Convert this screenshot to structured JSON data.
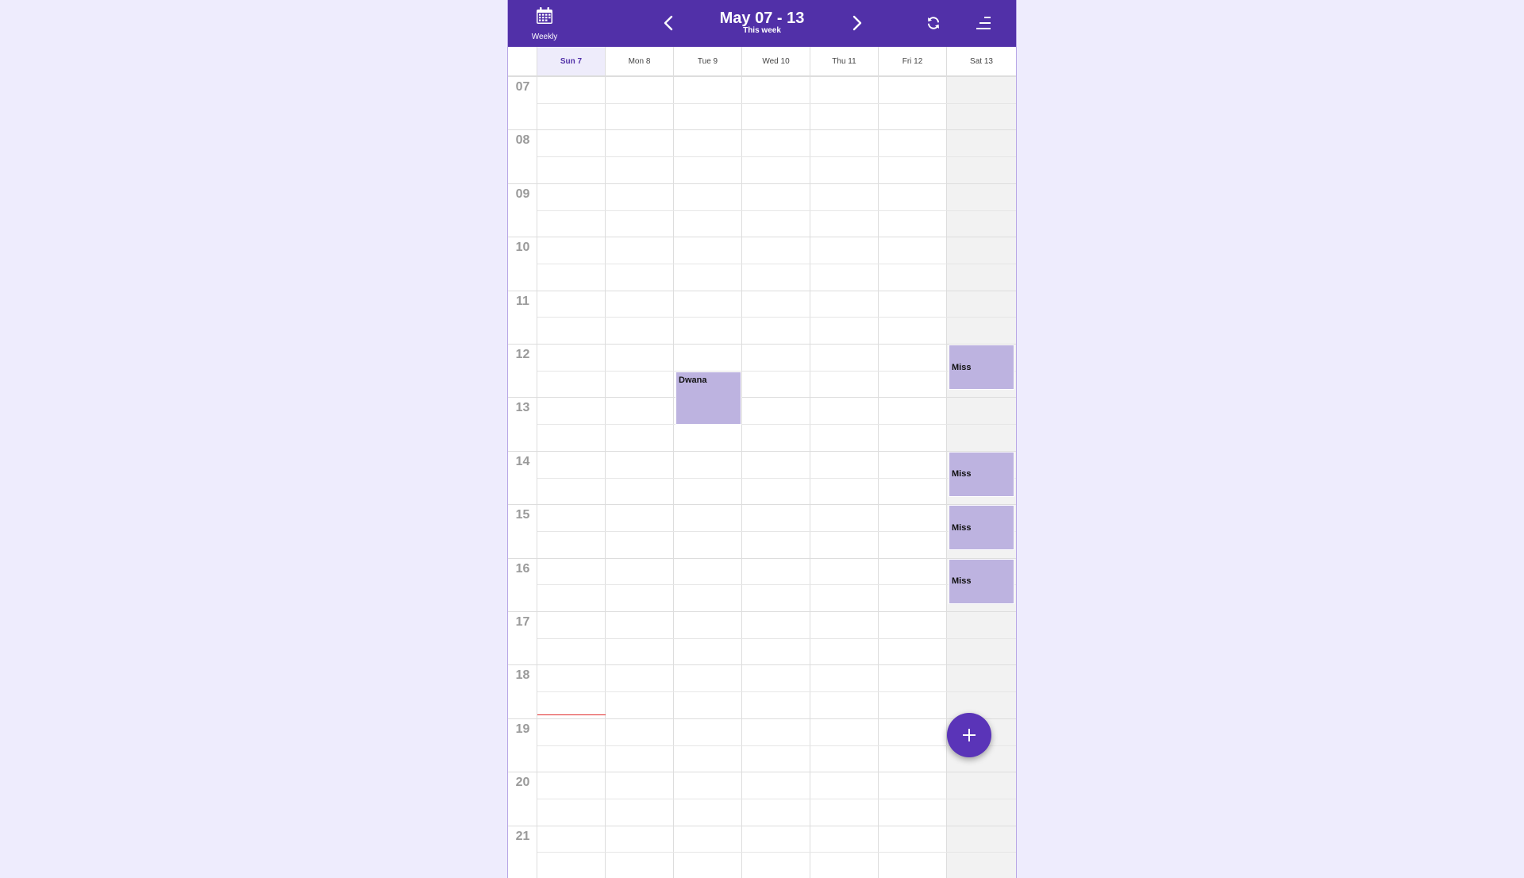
{
  "topbar": {
    "view_label": "Weekly",
    "view_icon": "calendar-icon",
    "title": "May 07 - 13",
    "subtitle": "This week",
    "prev_icon": "chevron-left-icon",
    "next_icon": "chevron-right-icon",
    "refresh_icon": "refresh-icon",
    "menu_icon": "menu-icon",
    "background_color": "#5130a8"
  },
  "days": [
    {
      "label": "Sun 7",
      "today": true,
      "weekend": false
    },
    {
      "label": "Mon 8",
      "today": false,
      "weekend": false
    },
    {
      "label": "Tue 9",
      "today": false,
      "weekend": false
    },
    {
      "label": "Wed 10",
      "today": false,
      "weekend": false
    },
    {
      "label": "Thu 11",
      "today": false,
      "weekend": false
    },
    {
      "label": "Fri 12",
      "today": false,
      "weekend": false
    },
    {
      "label": "Sat 13",
      "today": false,
      "weekend": true
    }
  ],
  "hours": [
    "07",
    "08",
    "09",
    "10",
    "11",
    "12",
    "13",
    "14",
    "15",
    "16",
    "17",
    "18",
    "19",
    "20",
    "21"
  ],
  "events": [
    {
      "title": "Miss",
      "day_index": 6,
      "start_hour": 12.0,
      "end_hour": 12.85
    },
    {
      "title": "Dwana",
      "day_index": 2,
      "start_hour": 12.5,
      "end_hour": 13.5
    },
    {
      "title": "Miss",
      "day_index": 6,
      "start_hour": 14.0,
      "end_hour": 14.85
    },
    {
      "title": "Miss",
      "day_index": 6,
      "start_hour": 15.0,
      "end_hour": 15.85
    },
    {
      "title": "Miss",
      "day_index": 6,
      "start_hour": 16.0,
      "end_hour": 16.85
    }
  ],
  "current_time_hour": 19.0,
  "add_button_icon": "plus-icon",
  "colors": {
    "accent": "#5130a8",
    "event_fill": "#bdb3e0",
    "now_line": "#e02a2a",
    "page_background": "#eeecfd"
  }
}
